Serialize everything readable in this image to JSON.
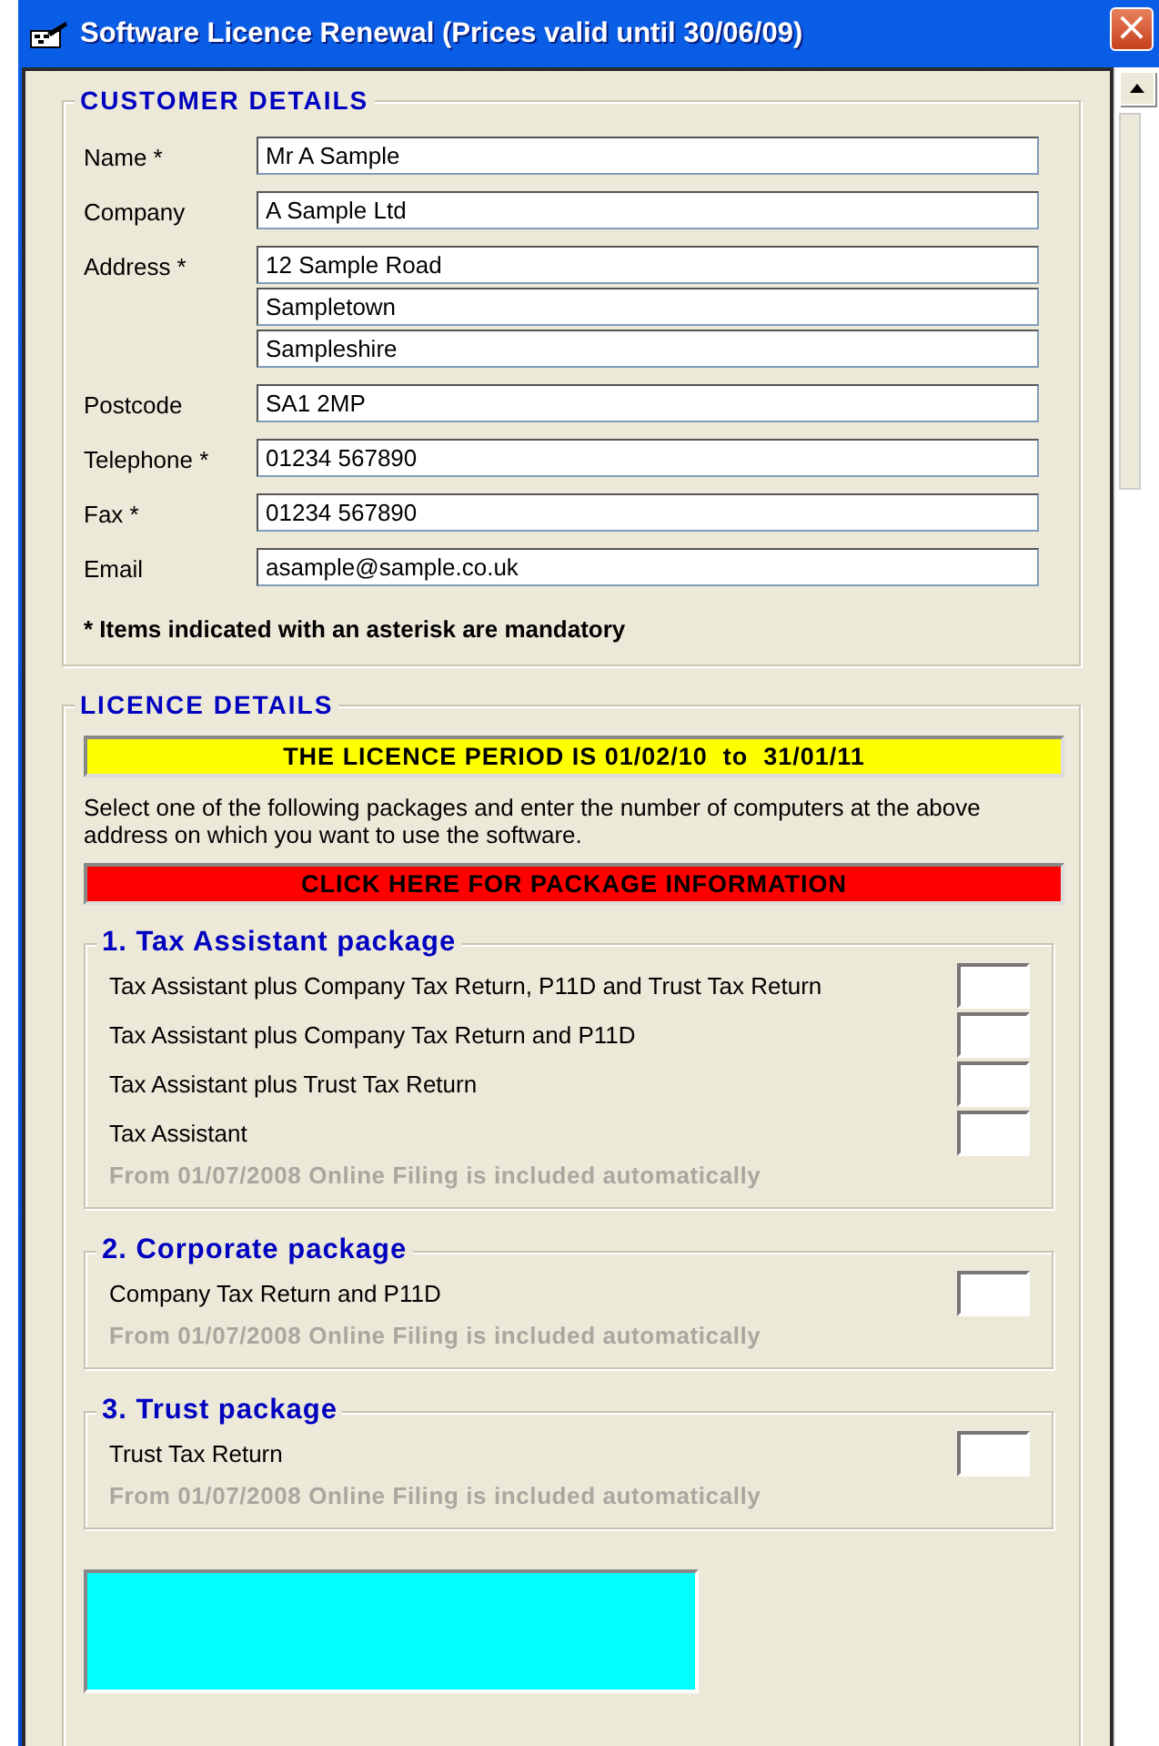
{
  "window": {
    "title": "Software Licence Renewal (Prices valid until 30/06/09)",
    "close": "×"
  },
  "customer_details": {
    "title": "CUSTOMER DETAILS",
    "fields": [
      {
        "label": "Name *",
        "lines": [
          "Mr A Sample"
        ]
      },
      {
        "label": "Company",
        "lines": [
          "A Sample Ltd"
        ]
      },
      {
        "label": "Address *",
        "lines": [
          "12 Sample Road",
          "Sampletown",
          "Sampleshire"
        ]
      },
      {
        "label": "Postcode",
        "lines": [
          "SA1 2MP"
        ]
      },
      {
        "label": "Telephone *",
        "lines": [
          "01234 567890"
        ]
      },
      {
        "label": "Fax *",
        "lines": [
          "01234 567890"
        ]
      },
      {
        "label": "Email",
        "lines": [
          "asample@sample.co.uk"
        ]
      }
    ],
    "note": "* Items indicated with an asterisk are mandatory"
  },
  "licence_details": {
    "title": "LICENCE DETAILS",
    "period_banner": "THE LICENCE PERIOD IS 01/02/10  to  31/01/11",
    "instructions": "Select one of the following packages and enter the number of computers at the above address on which you want to use the software.",
    "info_button": "CLICK HERE FOR PACKAGE INFORMATION",
    "packages": [
      {
        "title": "1. Tax Assistant package",
        "options": [
          "Tax Assistant plus Company Tax Return, P11D and Trust Tax Return",
          "Tax Assistant plus Company Tax Return and P11D",
          "Tax Assistant plus Trust Tax Return",
          "Tax Assistant"
        ],
        "note": "From 01/07/2008 Online Filing is included automatically"
      },
      {
        "title": "2. Corporate package",
        "options": [
          "Company Tax Return and P11D"
        ],
        "note": "From 01/07/2008 Online Filing is included automatically"
      },
      {
        "title": "3. Trust package",
        "options": [
          "Trust Tax Return"
        ],
        "note": "From 01/07/2008 Online Filing is included automatically"
      }
    ]
  }
}
